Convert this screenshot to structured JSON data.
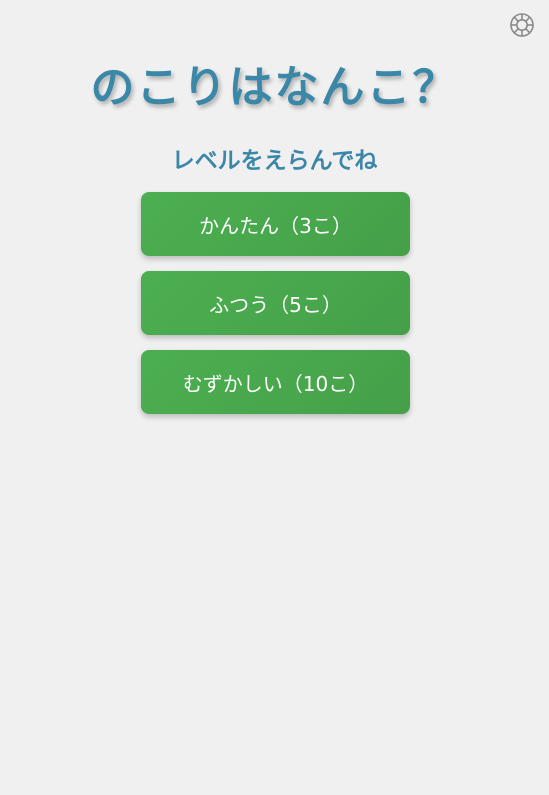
{
  "header": {
    "settings_icon": "gear-icon"
  },
  "title": "のこりはなんこ？",
  "subtitle": "レベルをえらんでね",
  "levels": [
    {
      "label": "かんたん（3こ）"
    },
    {
      "label": "ふつう（5こ）"
    },
    {
      "label": "むずかしい（10こ）"
    }
  ],
  "colors": {
    "background": "#f0f0f0",
    "title": "#3a87a8",
    "button": "#4caf50",
    "button_text": "#ffffff",
    "icon": "#8a8a8a"
  }
}
